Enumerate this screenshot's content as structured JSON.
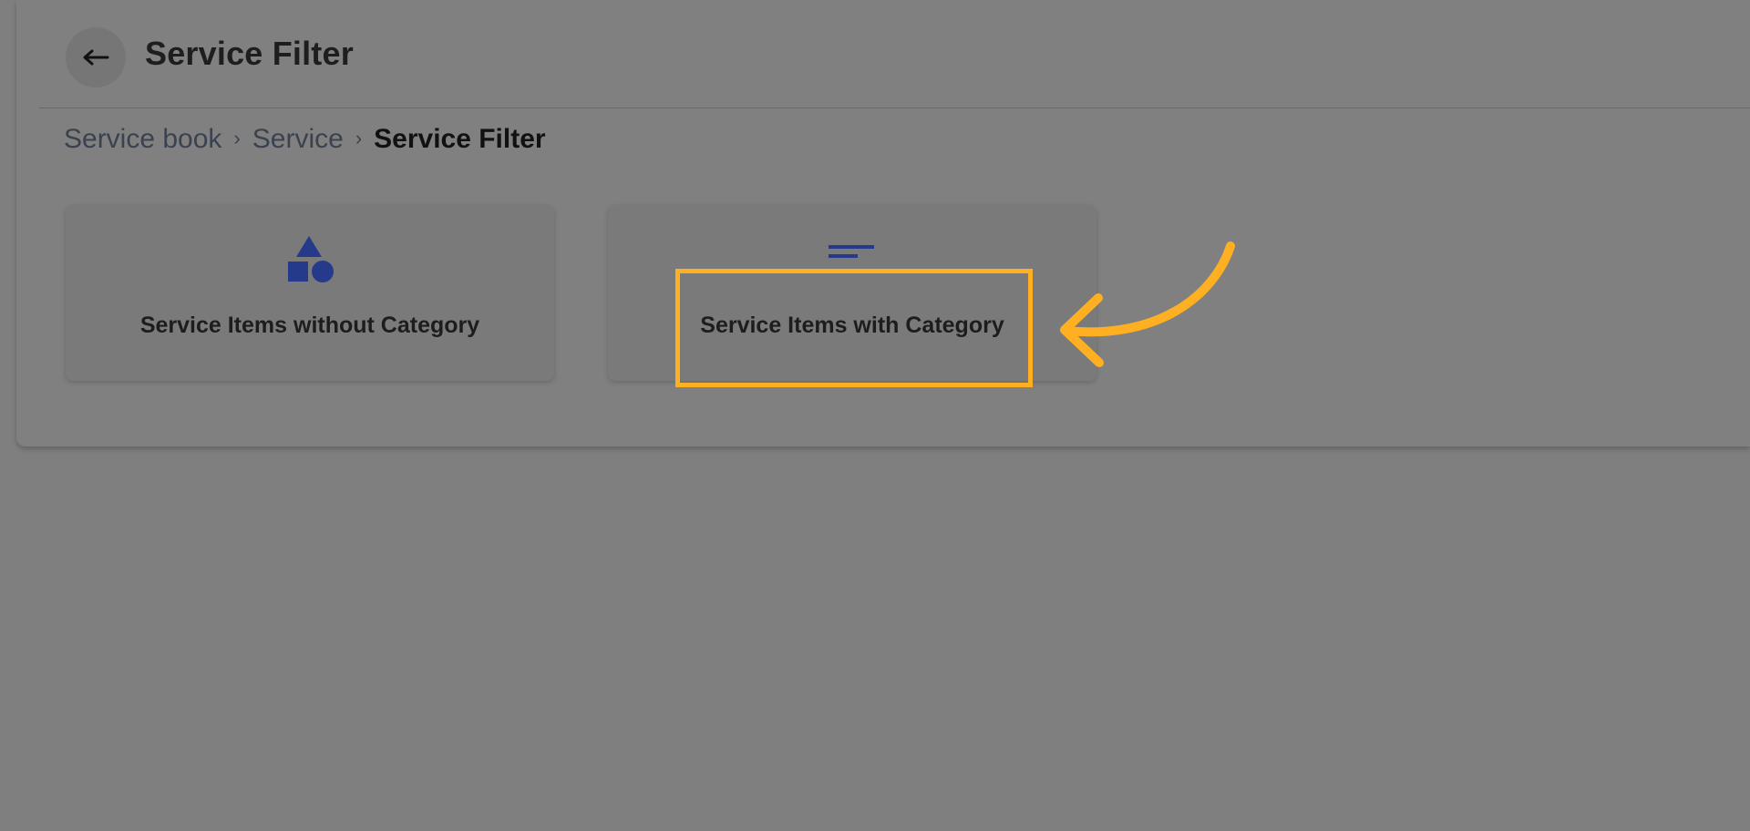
{
  "header": {
    "back_icon": "arrow-left-icon",
    "title": "Service Filter"
  },
  "breadcrumb": {
    "items": [
      "Service book",
      "Service"
    ],
    "separator": "›",
    "current": "Service Filter"
  },
  "cards": [
    {
      "label": "Service Items without Category",
      "icon": "shapes-icon"
    },
    {
      "label": "Service Items with Category",
      "icon": "sort-lines-icon"
    }
  ],
  "colors": {
    "overlay": "#7f7f7f",
    "icon_accent": "#253a8a",
    "annotation": "#ffb022"
  }
}
